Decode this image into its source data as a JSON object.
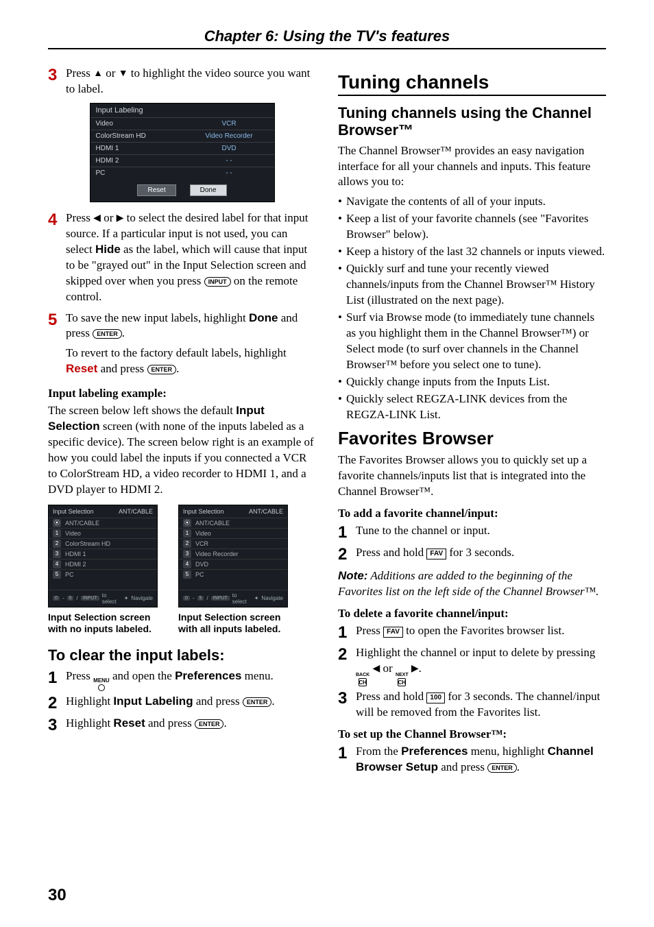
{
  "chapter_header": "Chapter 6: Using the TV's features",
  "page_number": "30",
  "left": {
    "step3": {
      "num": "3",
      "text_a": "Press ",
      "text_b": " or ",
      "text_c": " to highlight the video source you want to label."
    },
    "osd_large": {
      "title": "Input Labeling",
      "rows": [
        {
          "name": "Video",
          "val": "VCR"
        },
        {
          "name": "ColorStream HD",
          "val": "Video Recorder"
        },
        {
          "name": "HDMI 1",
          "val": "DVD"
        },
        {
          "name": "HDMI 2",
          "val": "- -"
        },
        {
          "name": "PC",
          "val": "- -"
        }
      ],
      "reset": "Reset",
      "done": "Done"
    },
    "step4": {
      "num": "4",
      "text_a": "Press ",
      "text_b": " or ",
      "text_c": " to select the desired label for that input source. If a particular input is not used, you can select ",
      "hide": "Hide",
      "text_d": " as the label, which will cause that input to be \"grayed out\" in the Input Selection screen and skipped over when you press ",
      "input_btn": "INPUT",
      "text_e": " on the remote control."
    },
    "step5": {
      "num": "5",
      "text_a": "To save the new input labels, highlight ",
      "done": "Done",
      "text_b": " and press ",
      "enter_btn": "ENTER",
      "text_c": ".",
      "revert_a": "To revert to the factory default labels, highlight ",
      "reset": "Reset",
      "revert_b": " and press ",
      "revert_c": "."
    },
    "ex_head": "Input labeling example:",
    "ex_p_a": "The screen below left shows the default ",
    "ex_bold": "Input Selection",
    "ex_p_b": " screen (with none of the inputs labeled as a specific device). The screen below right is an example of how you could label the inputs if you connected a VCR to ColorStream HD, a video recorder to HDMI 1, and a DVD player to HDMI 2.",
    "osd_small_left": {
      "title": "Input Selection",
      "src": "ANT/CABLE",
      "rows": [
        "ANT/CABLE",
        "Video",
        "ColorStream HD",
        "HDMI 1",
        "HDMI 2",
        "PC"
      ],
      "ft_input": "INPUT",
      "ft_sel": "to select",
      "ft_nav": "Navigate"
    },
    "osd_small_right": {
      "title": "Input Selection",
      "src": "ANT/CABLE",
      "rows": [
        "ANT/CABLE",
        "Video",
        "VCR",
        "Video Recorder",
        "DVD",
        "PC"
      ],
      "ft_input": "INPUT",
      "ft_sel": "to select",
      "ft_nav": "Navigate"
    },
    "caption_left": "Input Selection screen with no inputs labeled.",
    "caption_right": "Input Selection screen with all inputs labeled.",
    "clear_head": "To clear the input labels:",
    "clear1": {
      "num": "1",
      "a": "Press ",
      "menu": "MENU",
      "b": " and open the ",
      "pref": "Preferences",
      "c": " menu."
    },
    "clear2": {
      "num": "2",
      "a": "Highlight ",
      "il": "Input Labeling",
      "b": " and press ",
      "enter": "ENTER",
      "c": "."
    },
    "clear3": {
      "num": "3",
      "a": "Highlight ",
      "reset": "Reset",
      "b": " and press ",
      "enter": "ENTER",
      "c": "."
    }
  },
  "right": {
    "h1": "Tuning channels",
    "h2a": "Tuning channels using the Channel Browser™",
    "p1": "The Channel Browser™ provides an easy navigation interface for all your channels and inputs. This feature allows you to:",
    "bullets": [
      "Navigate the contents of all of your inputs.",
      "Keep a list of your favorite channels (see \"Favorites Browser\" below).",
      "Keep a history of the last 32 channels or inputs viewed.",
      "Quickly surf and tune your recently viewed channels/inputs from the Channel Browser™ History List (illustrated on the next page).",
      "Surf via Browse mode (to immediately tune channels as you highlight them in the Channel Browser™) or Select mode (to surf over channels in the Channel Browser™ before you select one to tune).",
      "Quickly change inputs from the Inputs List.",
      "Quickly select REGZA-LINK devices from the REGZA-LINK List."
    ],
    "h2b": "Favorites Browser",
    "p2": "The Favorites Browser allows you to quickly set up a favorite channels/inputs list that is integrated into the Channel Browser™.",
    "add_head": "To add a favorite channel/input:",
    "add1": {
      "num": "1",
      "text": "Tune to the channel or input."
    },
    "add2": {
      "num": "2",
      "a": "Press and hold ",
      "fav": "FAV",
      "b": " for 3 seconds."
    },
    "note_label": "Note:",
    "note_text": " Additions are added to the beginning of the Favorites list on the left side of the Channel Browser™.",
    "del_head": "To delete a favorite channel/input:",
    "del1": {
      "num": "1",
      "a": "Press ",
      "fav": "FAV",
      "b": " to open the Favorites browser list."
    },
    "del2": {
      "num": "2",
      "a": "Highlight the channel or input to delete by pressing ",
      "back": "BACK",
      "ch": "CH",
      "b": " or ",
      "next": "NEXT",
      "c": "."
    },
    "del3": {
      "num": "3",
      "a": "Press and hold ",
      "hundred": "1̄0̄0̄",
      "b": " for 3 seconds. The channel/input will be removed from the Favorites list."
    },
    "setup_head": "To set up the Channel Browser™:",
    "setup1": {
      "num": "1",
      "a": "From the ",
      "pref": "Preferences",
      "b": " menu, highlight ",
      "cbs": "Channel Browser Setup",
      "c": " and press ",
      "enter": "ENTER",
      "d": "."
    }
  }
}
